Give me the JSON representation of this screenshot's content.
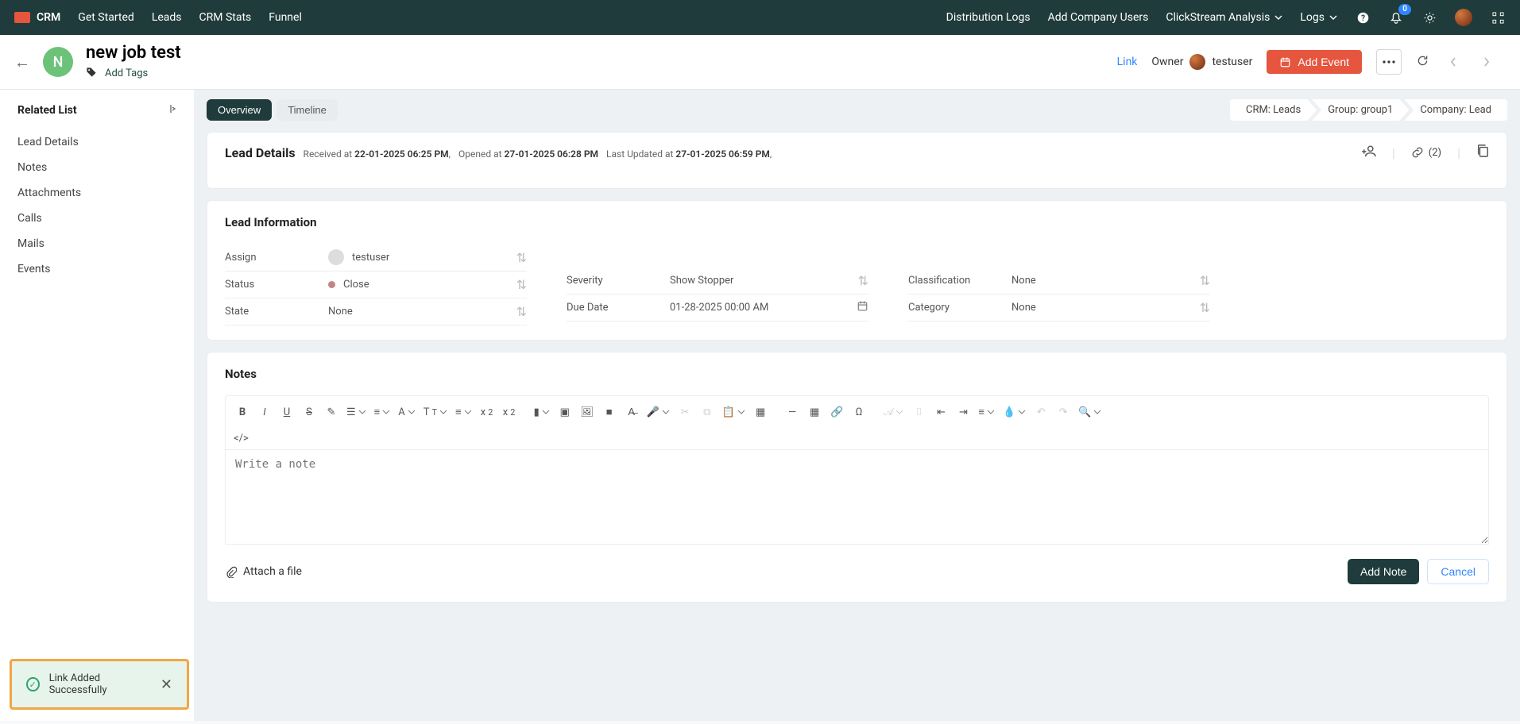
{
  "topnav": {
    "brand": "CRM",
    "left": [
      "Get Started",
      "Leads",
      "CRM Stats",
      "Funnel"
    ],
    "right_links": [
      "Distribution Logs",
      "Add Company Users"
    ],
    "right_dd": [
      "ClickStream Analysis",
      "Logs"
    ],
    "badge": "0"
  },
  "header": {
    "avatar_letter": "N",
    "title": "new job test",
    "add_tags": "Add Tags",
    "link_label": "Link",
    "owner_label": "Owner",
    "owner_name": "testuser",
    "add_event": "Add Event"
  },
  "sidebar": {
    "title": "Related List",
    "items": [
      "Lead Details",
      "Notes",
      "Attachments",
      "Calls",
      "Mails",
      "Events"
    ]
  },
  "tabs": {
    "overview": "Overview",
    "timeline": "Timeline"
  },
  "crumbs": [
    "CRM: Leads",
    "Group: group1",
    "Company: Lead"
  ],
  "lead_details": {
    "title": "Lead Details",
    "received_label": "Received at ",
    "received_at": "22-01-2025 06:25 PM",
    "opened_label": "Opened at ",
    "opened_at": "27-01-2025 06:28 PM",
    "updated_label": "Last Updated at ",
    "updated_at": "27-01-2025 06:59 PM",
    "link_count": "(2)"
  },
  "lead_info": {
    "title": "Lead Information",
    "assign_label": "Assign",
    "assign_val": "testuser",
    "status_label": "Status",
    "status_val": "Close",
    "state_label": "State",
    "state_val": "None",
    "severity_label": "Severity",
    "severity_val": "Show Stopper",
    "due_label": "Due Date",
    "due_val": "01-28-2025 00:00 AM",
    "class_label": "Classification",
    "class_val": "None",
    "category_label": "Category",
    "category_val": "None"
  },
  "notes": {
    "title": "Notes",
    "code_symbol": "</>",
    "placeholder": "Write a note",
    "attach": "Attach a file",
    "add": "Add Note",
    "cancel": "Cancel"
  },
  "toast": {
    "msg": "Link Added Successfully"
  }
}
